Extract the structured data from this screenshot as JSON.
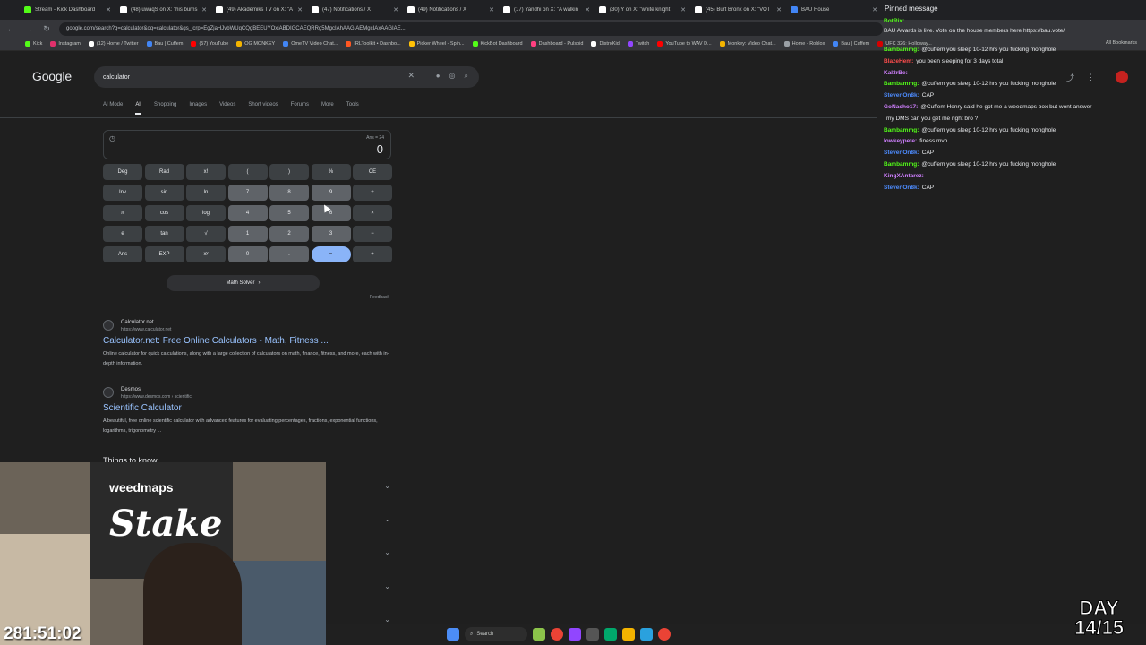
{
  "tabs": [
    {
      "label": "Stream - Kick Dashboard",
      "color": "#53fc18"
    },
    {
      "label": "(48) uwaqS on X: \"his burns",
      "color": "#ffffff"
    },
    {
      "label": "(49) Akademiks TV on X: \"A",
      "color": "#ffffff"
    },
    {
      "label": "(47) Notifications / X",
      "color": "#ffffff"
    },
    {
      "label": "(49) Notifications / X",
      "color": "#ffffff"
    },
    {
      "label": "(17) Yandhi on X: \"A walkin",
      "color": "#ffffff"
    },
    {
      "label": "(30) Y on X: \"white knight",
      "color": "#ffffff"
    },
    {
      "label": "(45) Burt Bronx on X: \"VOT",
      "color": "#ffffff"
    },
    {
      "label": "BAU House",
      "color": "#4285f4"
    }
  ],
  "address": "google.com/search?q=calculator&oq=calculator&gs_lcrp=EgZjaHJvbWUqCQgBEEUYOxiABDIGCAEQRRg5MgcIAhAAGIAEMgcIAxAAGIAE...",
  "bookmarks": [
    {
      "label": "Kick",
      "color": "#53fc18"
    },
    {
      "label": "Instagram",
      "color": "#e1306c"
    },
    {
      "label": "(12) Home / Twitter",
      "color": "#ffffff"
    },
    {
      "label": "Bau | Cuffem",
      "color": "#4285f4"
    },
    {
      "label": "(57) YouTube",
      "color": "#ff0000"
    },
    {
      "label": "OG MONKEY",
      "color": "#f4b400"
    },
    {
      "label": "OmeTV Video Chat...",
      "color": "#4285f4"
    },
    {
      "label": "IRLToolkit • Dashbo...",
      "color": "#ff5722"
    },
    {
      "label": "Picker Wheel - Spin...",
      "color": "#ffc107"
    },
    {
      "label": "KickBot Dashboard",
      "color": "#53fc18"
    },
    {
      "label": "Dashboard - Pulsoid",
      "color": "#ff4081"
    },
    {
      "label": "DistroKid",
      "color": "#ffffff"
    },
    {
      "label": "Twitch",
      "color": "#9146ff"
    },
    {
      "label": "YouTube to WAV D...",
      "color": "#ff0000"
    },
    {
      "label": "Monkey: Video Chat...",
      "color": "#f4b400"
    },
    {
      "label": "Home - Roblox",
      "color": "#9aa0a6"
    },
    {
      "label": "Bau | Cuffem",
      "color": "#4285f4"
    },
    {
      "label": "UFC 326: Holloway...",
      "color": "#d50000"
    }
  ],
  "all_bookmarks": "All Bookmarks",
  "google": {
    "logo": "Google",
    "query": "calculator",
    "tabs": [
      "AI Mode",
      "All",
      "Shopping",
      "Images",
      "Videos",
      "Short videos",
      "Forums",
      "More",
      "Tools"
    ]
  },
  "calculator": {
    "ans_line": "Ans = 24",
    "result": "0",
    "keys": [
      {
        "label": "Deg",
        "kind": "fn"
      },
      {
        "label": "Rad",
        "kind": "fn"
      },
      {
        "label": "x!",
        "kind": "fn"
      },
      {
        "label": "(",
        "kind": "fn"
      },
      {
        "label": ")",
        "kind": "fn"
      },
      {
        "label": "%",
        "kind": "fn"
      },
      {
        "label": "CE",
        "kind": "fn"
      },
      {
        "label": "Inv",
        "kind": "fn"
      },
      {
        "label": "sin",
        "kind": "fn"
      },
      {
        "label": "ln",
        "kind": "fn"
      },
      {
        "label": "7",
        "kind": "num"
      },
      {
        "label": "8",
        "kind": "num"
      },
      {
        "label": "9",
        "kind": "num"
      },
      {
        "label": "÷",
        "kind": "fn"
      },
      {
        "label": "π",
        "kind": "fn"
      },
      {
        "label": "cos",
        "kind": "fn"
      },
      {
        "label": "log",
        "kind": "fn"
      },
      {
        "label": "4",
        "kind": "num"
      },
      {
        "label": "5",
        "kind": "num"
      },
      {
        "label": "6",
        "kind": "num"
      },
      {
        "label": "×",
        "kind": "fn"
      },
      {
        "label": "e",
        "kind": "fn"
      },
      {
        "label": "tan",
        "kind": "fn"
      },
      {
        "label": "√",
        "kind": "fn"
      },
      {
        "label": "1",
        "kind": "num"
      },
      {
        "label": "2",
        "kind": "num"
      },
      {
        "label": "3",
        "kind": "num"
      },
      {
        "label": "−",
        "kind": "fn"
      },
      {
        "label": "Ans",
        "kind": "fn"
      },
      {
        "label": "EXP",
        "kind": "fn"
      },
      {
        "label": "xʸ",
        "kind": "fn"
      },
      {
        "label": "0",
        "kind": "num"
      },
      {
        "label": ".",
        "kind": "num"
      },
      {
        "label": "=",
        "kind": "eq"
      },
      {
        "label": "+",
        "kind": "fn"
      }
    ],
    "math_solver": "Math Solver",
    "feedback": "Feedback"
  },
  "results": [
    {
      "site": "Calculator.net",
      "url": "https://www.calculator.net",
      "title": "Calculator.net: Free Online Calculators - Math, Fitness ...",
      "snippet": "Online calculator for quick calculations, along with a large collection of calculators on math, finance, fitness, and more, each with in-depth information."
    },
    {
      "site": "Desmos",
      "url": "https://www.desmos.com › scientific",
      "title": "Scientific Calculator",
      "snippet": "A beautiful, free online scientific calculator with advanced features for evaluating percentages, fractions, exponential functions, logarithms, trigonometry ..."
    }
  ],
  "things_to_know": "Things to know",
  "chat": {
    "pinned_header": "Pinned message",
    "pinned_user": "BotRix:",
    "pinned_text": "BAU Awards is live. Vote on the house members here https://bau.vote/",
    "messages": [
      {
        "user": "Bambammg:",
        "text": "@cuffem you sleep 10-12 hrs you fucking monghole",
        "color": "#53fc18"
      },
      {
        "user": "BlazeHem:",
        "text": "you been sleeping for 3 days total",
        "color": "#ff4d4d"
      },
      {
        "user": "Kal3rBe:",
        "text": "",
        "color": "#d080ff"
      },
      {
        "user": "Bambammg:",
        "text": "@cuffem you sleep 10-12 hrs you fucking monghole",
        "color": "#53fc18"
      },
      {
        "user": "StevenOn8k:",
        "text": "CAP",
        "color": "#4d8cff"
      },
      {
        "user": "GoNacho17:",
        "text": "@Cuffem Henry said he got me a weedmaps box but wont answer",
        "color": "#d080ff"
      },
      {
        "user": "",
        "text": "my DMS can you get me right bro ?",
        "color": "#ffffff"
      },
      {
        "user": "Bambammg:",
        "text": "@cuffem you sleep 10-12 hrs you fucking monghole",
        "color": "#53fc18"
      },
      {
        "user": "lowkeypete:",
        "text": "finess mvp",
        "color": "#d080ff"
      },
      {
        "user": "StevenOn8k:",
        "text": "CAP",
        "color": "#4d8cff"
      },
      {
        "user": "Bambammg:",
        "text": "@cuffem you sleep 10-12 hrs you fucking monghole",
        "color": "#53fc18"
      },
      {
        "user": "KingXAntarez:",
        "text": "",
        "color": "#d080ff"
      },
      {
        "user": "StevenOn8k:",
        "text": "CAP",
        "color": "#4d8cff"
      }
    ]
  },
  "cam": {
    "brand_top": "weedmaps",
    "brand_main": "Stake"
  },
  "timer": "281:51:02",
  "day_badge": {
    "line1": "DAY",
    "line2": "14/15"
  },
  "taskbar": {
    "search": "Search"
  }
}
